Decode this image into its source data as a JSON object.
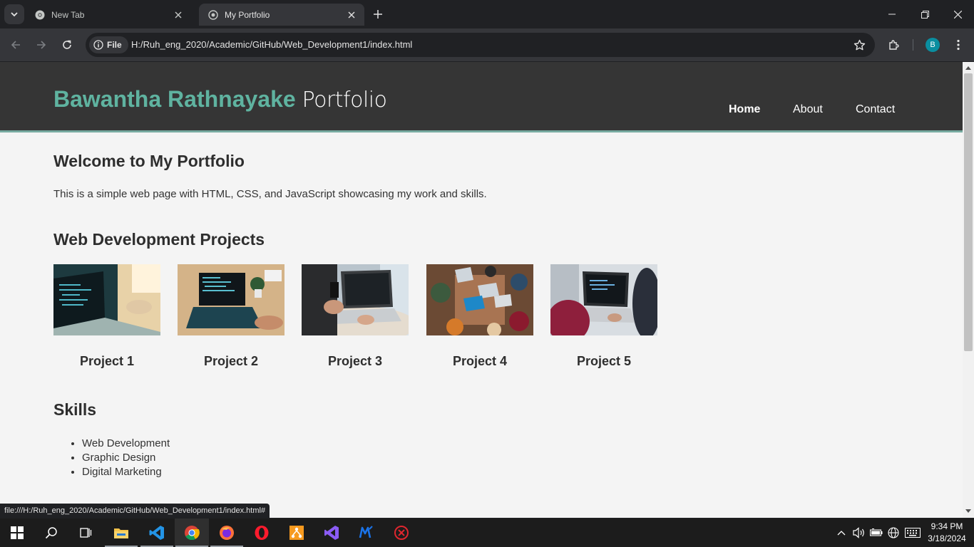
{
  "browser": {
    "tabs": [
      {
        "title": "New Tab",
        "active": false
      },
      {
        "title": "My Portfolio",
        "active": true
      }
    ],
    "security_chip": "File",
    "url": "H:/Ruh_eng_2020/Academic/GitHub/Web_Development1/index.html",
    "profile_initial": "B",
    "status_url": "file:///H:/Ruh_eng_2020/Academic/GitHub/Web_Development1/index.html#"
  },
  "site": {
    "brand_highlight": "Bawantha Rathnayake",
    "brand_rest": "Portfolio",
    "nav": [
      "Home",
      "About",
      "Contact"
    ],
    "welcome_heading": "Welcome to My Portfolio",
    "intro": "This is a simple web page with HTML, CSS, and JavaScript showcasing my work and skills.",
    "projects_heading": "Web Development Projects",
    "projects": [
      "Project 1",
      "Project 2",
      "Project 3",
      "Project 4",
      "Project 5"
    ],
    "skills_heading": "Skills",
    "skills": [
      "Web Development",
      "Graphic Design",
      "Digital Marketing"
    ]
  },
  "taskbar": {
    "apps": [
      "windows-start",
      "search",
      "task-view",
      "file-explorer",
      "vs-code",
      "chrome",
      "firefox",
      "opera",
      "sublime-merge",
      "visual-studio",
      "mongodb-compass",
      "antivirus"
    ],
    "time": "9:34 PM",
    "date": "3/18/2024"
  },
  "colors": {
    "accent": "#5fb3a0",
    "header_bg": "#353535",
    "page_bg": "#f4f4f4"
  }
}
